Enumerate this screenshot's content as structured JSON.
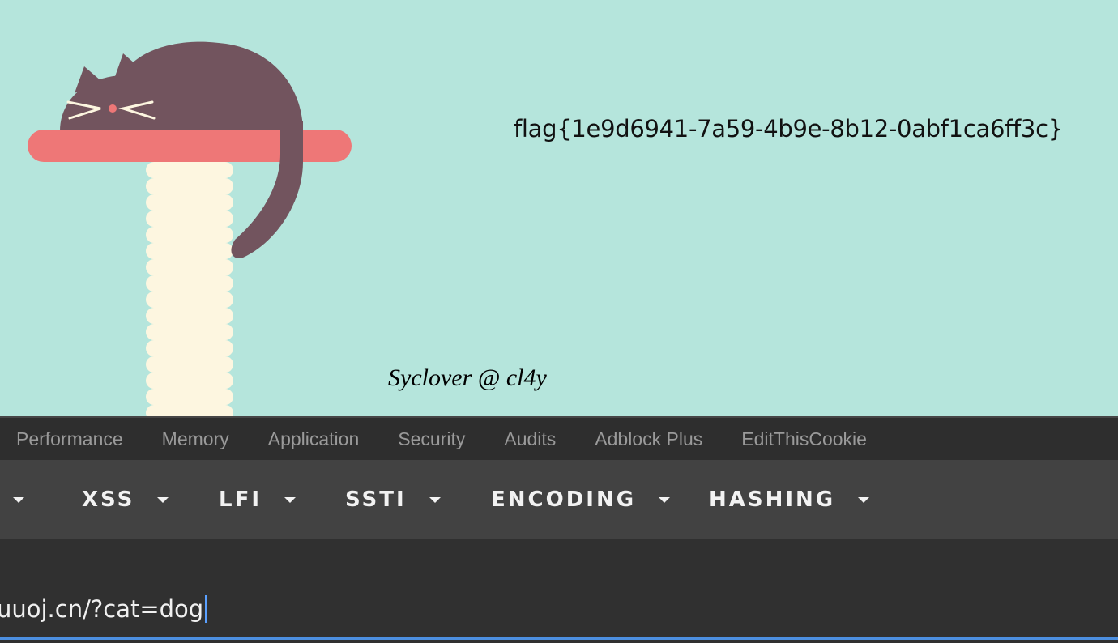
{
  "page": {
    "flag_text": "flag{1e9d6941-7a59-4b9e-8b12-0abf1ca6ff3c}",
    "signature": "Syclover @ cl4y"
  },
  "devtools": {
    "tabs": [
      "Performance",
      "Memory",
      "Application",
      "Security",
      "Audits",
      "Adblock Plus",
      "EditThisCookie"
    ]
  },
  "hackbar": {
    "menus": [
      "XSS",
      "LFI",
      "SSTI",
      "ENCODING",
      "HASHING"
    ],
    "url_value": "uuoj.cn/?cat=dog"
  },
  "colors": {
    "page_bg": "#b5e5dc",
    "cat": "#72545e",
    "perch": "#ee7777",
    "post": "#fdf6e0",
    "accent": "#4c8fe0"
  }
}
